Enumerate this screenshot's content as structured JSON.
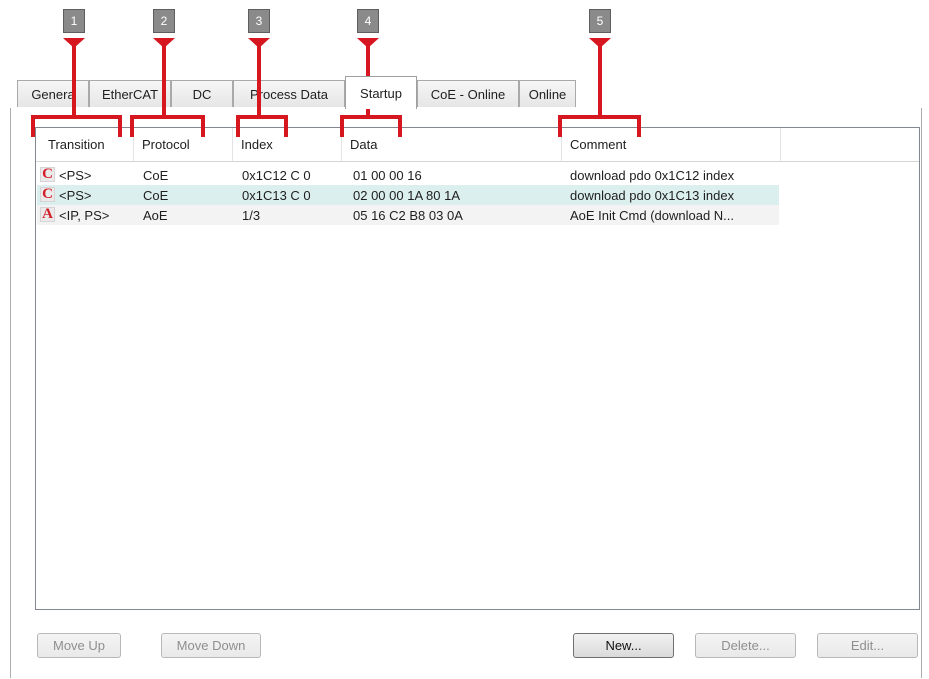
{
  "callouts": [
    "1",
    "2",
    "3",
    "4",
    "5"
  ],
  "tabs": [
    {
      "label": "Genera",
      "active": false
    },
    {
      "label": "EtherCAT",
      "active": false
    },
    {
      "label": "DC",
      "active": false
    },
    {
      "label": "Process Data",
      "active": false
    },
    {
      "label": "Startup",
      "active": true
    },
    {
      "label": "CoE - Online",
      "active": false
    },
    {
      "label": "Online",
      "active": false
    }
  ],
  "list": {
    "columns": [
      "Transition",
      "Protocol",
      "Index",
      "Data",
      "Comment"
    ],
    "rows": [
      {
        "badge": "C",
        "transition": "<PS>",
        "protocol": "CoE",
        "index": "0x1C12 C 0",
        "data": "01 00 00 16",
        "comment": "download pdo 0x1C12 index"
      },
      {
        "badge": "C",
        "transition": "<PS>",
        "protocol": "CoE",
        "index": "0x1C13 C 0",
        "data": "02 00 00 1A 80 1A",
        "comment": "download pdo 0x1C13 index"
      },
      {
        "badge": "A",
        "transition": "<IP, PS>",
        "protocol": "AoE",
        "index": "1/3",
        "data": "05 16 C2 B8 03 0A",
        "comment": "AoE Init Cmd (download N..."
      }
    ]
  },
  "buttons": {
    "move_up": "Move Up",
    "move_down": "Move Down",
    "new": "New...",
    "delete": "Delete...",
    "edit": "Edit..."
  },
  "colors": {
    "callout_accent": "#d7171f",
    "selected_row": "#dcefef",
    "badge_letter": "#d21f2a"
  }
}
